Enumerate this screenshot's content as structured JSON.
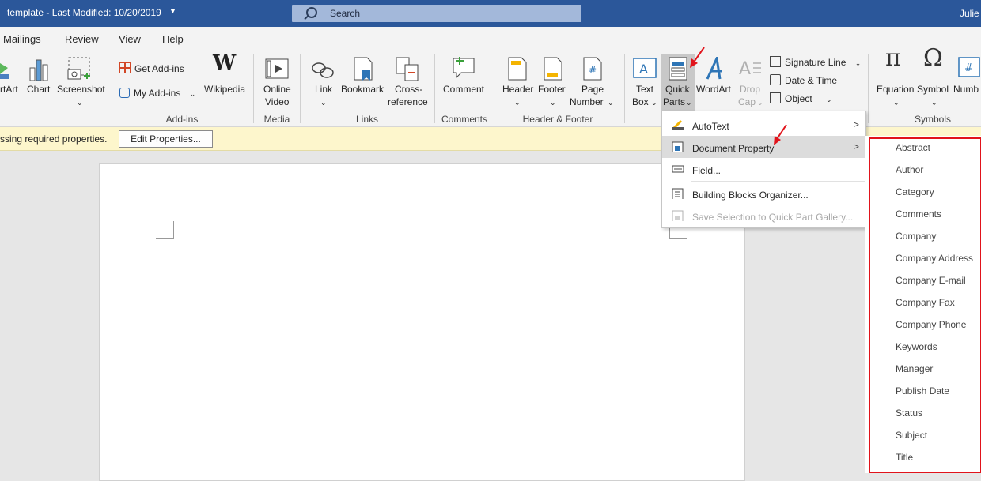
{
  "titlebar": {
    "doc_title": "template  -  Last Modified: 10/20/2019",
    "search_label": "Search",
    "user": "Julie"
  },
  "tabs": [
    "Mailings",
    "Review",
    "View",
    "Help"
  ],
  "ribbon": {
    "illustrations": {
      "smartart": "rtArt",
      "chart": "Chart",
      "screenshot": "Screenshot"
    },
    "addins": {
      "get": "Get Add-ins",
      "my": "My Add-ins",
      "wikipedia": "Wikipedia",
      "group": "Add-ins"
    },
    "media": {
      "video_line1": "Online",
      "video_line2": "Video",
      "group": "Media"
    },
    "links": {
      "link": "Link",
      "bookmark": "Bookmark",
      "xref_line1": "Cross-",
      "xref_line2": "reference",
      "group": "Links"
    },
    "comments": {
      "comment": "Comment",
      "group": "Comments"
    },
    "headerfooter": {
      "header": "Header",
      "footer": "Footer",
      "pagenum_line1": "Page",
      "pagenum_line2": "Number",
      "group": "Header & Footer"
    },
    "text": {
      "textbox_line1": "Text",
      "textbox_line2": "Box",
      "quickparts_line1": "Quick",
      "quickparts_line2": "Parts",
      "wordart": "WordArt",
      "dropcap_line1": "Drop",
      "dropcap_line2": "Cap",
      "signature": "Signature Line",
      "datetime": "Date & Time",
      "object": "Object"
    },
    "symbols": {
      "equation": "Equation",
      "symbol": "Symbol",
      "number": "Numb",
      "group": "Symbols"
    }
  },
  "message_bar": {
    "text": "ssing required properties.",
    "button": "Edit Properties..."
  },
  "quickparts_menu": {
    "items": [
      {
        "label": "AutoText",
        "submenu": true
      },
      {
        "label": "Document Property",
        "submenu": true
      },
      {
        "label": "Field..."
      },
      {
        "label": "Building Blocks Organizer..."
      },
      {
        "label": "Save Selection to Quick Part Gallery..."
      }
    ]
  },
  "property_submenu": [
    "Abstract",
    "Author",
    "Category",
    "Comments",
    "Company",
    "Company Address",
    "Company E-mail",
    "Company Fax",
    "Company Phone",
    "Keywords",
    "Manager",
    "Publish Date",
    "Status",
    "Subject",
    "Title"
  ],
  "colors": {
    "titlebar": "#2b579a",
    "annotation_red": "#e1131b",
    "message_bar": "#fdf6cc"
  }
}
